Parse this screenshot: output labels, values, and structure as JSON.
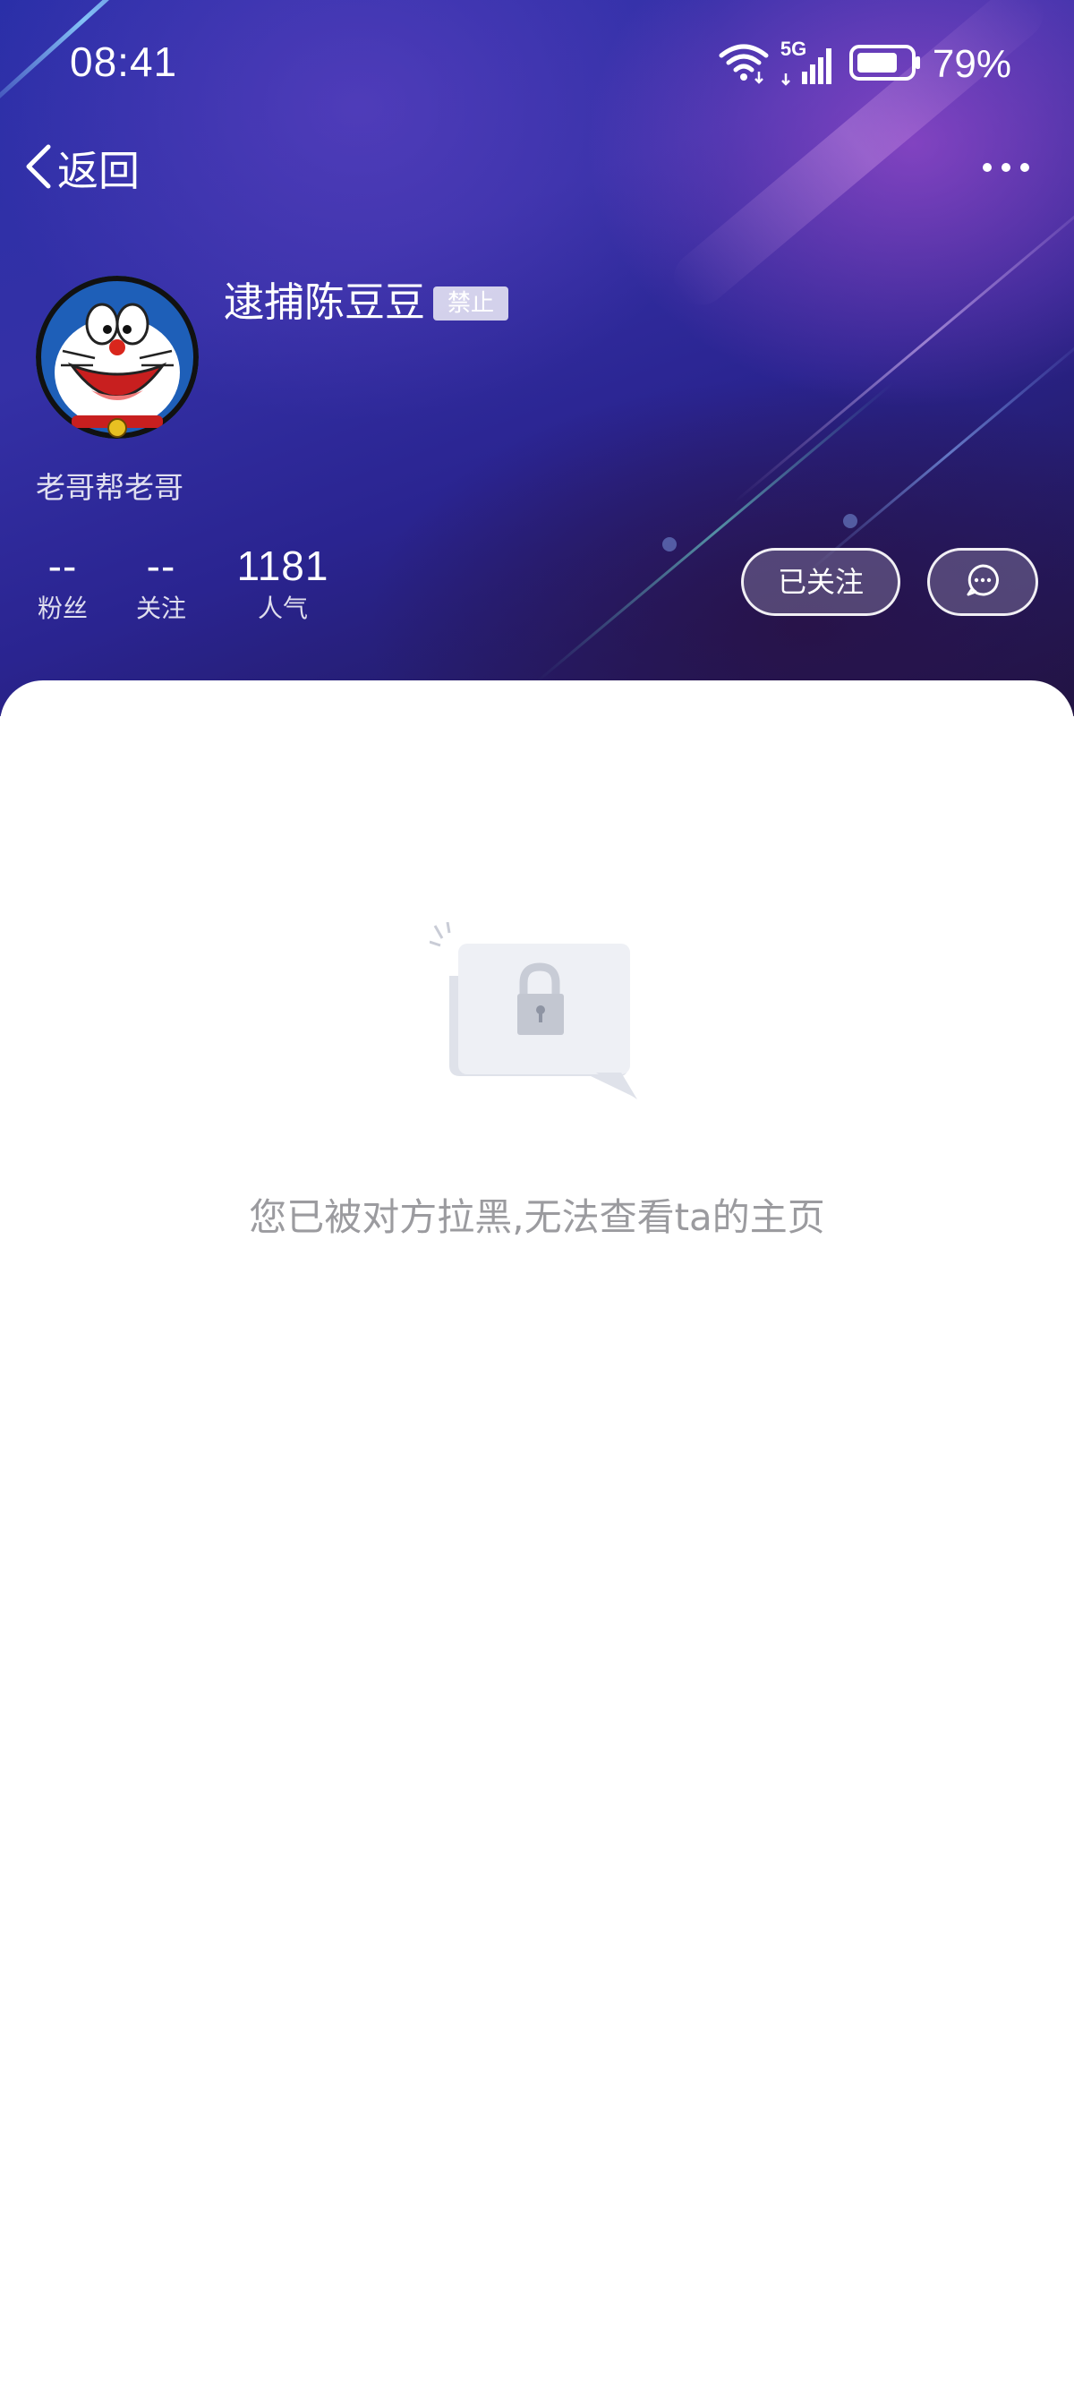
{
  "status_bar": {
    "time": "08:41",
    "network_label": "5G",
    "battery_percent": "79%",
    "icons": [
      "wifi-icon",
      "cellular-signal-icon",
      "battery-icon"
    ]
  },
  "nav": {
    "back_label": "返回",
    "back_icon": "chevron-left-icon",
    "more_icon": "more-dots-icon"
  },
  "profile": {
    "username": "逮捕陈豆豆",
    "ban_badge": "禁止",
    "signature": "老哥帮老哥",
    "avatar": "doraemon-avatar"
  },
  "stats": [
    {
      "value": "--",
      "label": "粉丝"
    },
    {
      "value": "--",
      "label": "关注"
    },
    {
      "value": "1181",
      "label": "人气"
    }
  ],
  "actions": {
    "follow_label": "已关注",
    "message_icon": "chat-bubble-icon"
  },
  "blocked": {
    "message": "您已被对方拉黑,无法查看ta的主页",
    "illustration": "lock-icon"
  },
  "colors": {
    "hero_top": "#2a2fa8",
    "hero_bottom": "#1f1440",
    "accent_pink": "#c456dc",
    "text_muted": "#9b9b9f"
  }
}
